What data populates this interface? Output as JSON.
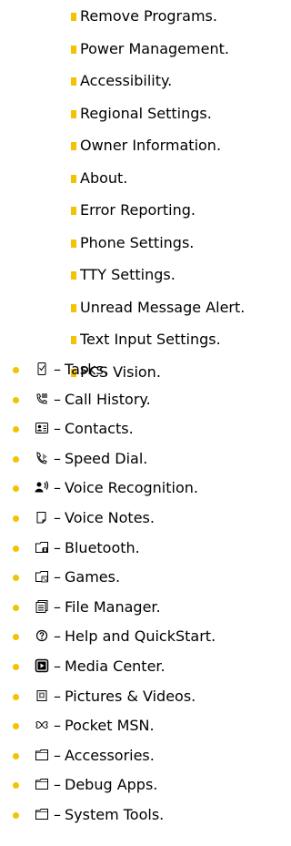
{
  "settings_subitems": [
    "Remove Programs.",
    "Power Management.",
    "Accessibility.",
    "Regional Settings.",
    "Owner Information.",
    "About.",
    "Error Reporting.",
    "Phone Settings.",
    "TTY Settings.",
    "Unread Message Alert.",
    "Text Input Settings.",
    "PCS Vision."
  ],
  "programs": [
    {
      "icon": "tasks-icon",
      "label": "Tasks."
    },
    {
      "icon": "call-history-icon",
      "label": "Call History."
    },
    {
      "icon": "contacts-icon",
      "label": "Contacts."
    },
    {
      "icon": "speed-dial-icon",
      "label": "Speed Dial."
    },
    {
      "icon": "voice-recognition-icon",
      "label": "Voice Recognition."
    },
    {
      "icon": "voice-notes-icon",
      "label": "Voice Notes."
    },
    {
      "icon": "bluetooth-folder-icon",
      "label": "Bluetooth."
    },
    {
      "icon": "games-folder-icon",
      "label": "Games."
    },
    {
      "icon": "file-manager-icon",
      "label": "File Manager."
    },
    {
      "icon": "help-icon",
      "label": "Help and QuickStart."
    },
    {
      "icon": "media-center-icon",
      "label": "Media Center."
    },
    {
      "icon": "pictures-videos-icon",
      "label": "Pictures & Videos."
    },
    {
      "icon": "pocket-msn-icon",
      "label": "Pocket MSN."
    },
    {
      "icon": "folder-icon",
      "label": "Accessories."
    },
    {
      "icon": "folder-icon",
      "label": "Debug Apps."
    },
    {
      "icon": "folder-icon",
      "label": "System Tools."
    }
  ],
  "separator": "–",
  "bullet_color": "#f2c300"
}
